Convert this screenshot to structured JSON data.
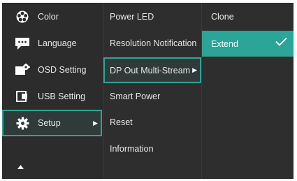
{
  "main_menu": {
    "items": [
      {
        "label": "Color",
        "icon": "color-wheel-icon"
      },
      {
        "label": "Language",
        "icon": "speech-bubble-icon"
      },
      {
        "label": "OSD Setting",
        "icon": "osd-setting-icon"
      },
      {
        "label": "USB Setting",
        "icon": "usb-setting-icon"
      },
      {
        "label": "Setup",
        "icon": "gear-icon"
      }
    ],
    "selected": "Setup",
    "scroll_up_icon": "triangle-up-icon"
  },
  "setup_menu": {
    "items": [
      {
        "label": "Power LED"
      },
      {
        "label": "Resolution Notification"
      },
      {
        "label": "DP Out Multi-Stream"
      },
      {
        "label": "Smart Power"
      },
      {
        "label": "Reset"
      },
      {
        "label": "Information"
      }
    ],
    "selected": "DP Out Multi-Stream"
  },
  "dp_out_menu": {
    "options": [
      {
        "label": "Clone"
      },
      {
        "label": "Extend"
      }
    ],
    "selected": "Extend",
    "checked_icon": "checkmark-icon"
  },
  "colors": {
    "accent": "#2aa598",
    "panel": "#2c2c2c",
    "text": "#e8e8e8"
  }
}
